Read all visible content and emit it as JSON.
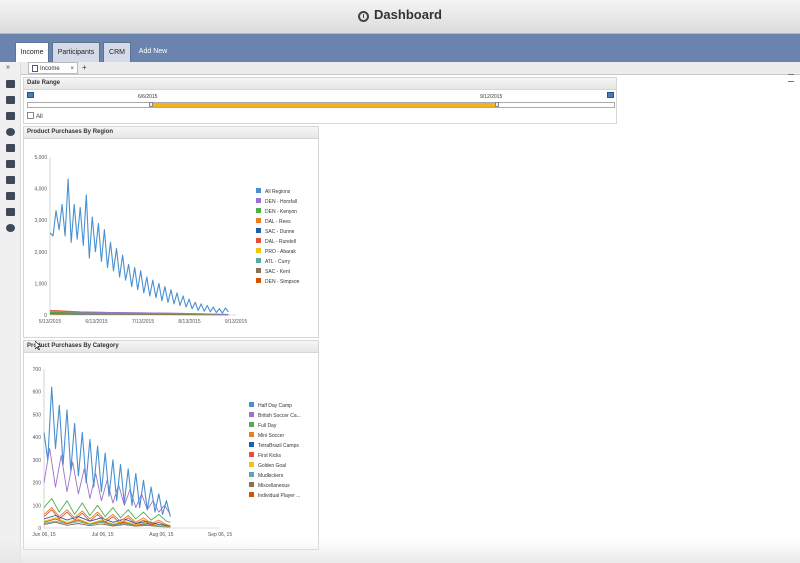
{
  "window": {
    "title": "Dashboard"
  },
  "tabs": [
    {
      "label": "Income",
      "active": true
    },
    {
      "label": "Participants",
      "active": false
    },
    {
      "label": "CRM",
      "active": false
    },
    {
      "label": "Add New",
      "active": false
    }
  ],
  "subtab": {
    "label": "Income",
    "close": "×",
    "add": "+"
  },
  "toolbar": {
    "expand": "»"
  },
  "date_range": {
    "title": "Date Range",
    "start": "6/6/2015",
    "end": "9/12/2015",
    "start_frac": 0.21,
    "end_frac": 0.8,
    "all_label": "All"
  },
  "colors": {
    "accent_range": "#f0b323",
    "tab_band": "#6b84ad"
  },
  "chart_data": [
    {
      "type": "line",
      "title": "Product Purchases By Region",
      "x_ticks": [
        "5/13/2015",
        "6/13/2015",
        "7/13/2015",
        "8/13/2015",
        "9/13/2015"
      ],
      "y_ticks": [
        "0",
        "1,000",
        "2,000",
        "3,000",
        "4,000",
        "5,000"
      ],
      "xlim": [
        0,
        123
      ],
      "ylim": [
        0,
        5000
      ],
      "grid": false,
      "legend": "right",
      "legend_entries": [
        "All Regions",
        "DEN - Horsfall",
        "DEN - Kenyon",
        "DAL - Rees",
        "SAC - Dunne",
        "DAL - Rundell",
        "PRO - Abarak",
        "ATL - Curry",
        "SAC - Kent",
        "DEN - Simpson"
      ],
      "series": [
        {
          "name": "All Regions",
          "color": "#4a90d0",
          "x": [
            0,
            2,
            4,
            6,
            8,
            10,
            12,
            14,
            16,
            18,
            20,
            22,
            24,
            26,
            28,
            30,
            32,
            34,
            36,
            38,
            40,
            42,
            44,
            46,
            48,
            50,
            52,
            54,
            56,
            58,
            60,
            62,
            64,
            66,
            68,
            70,
            72,
            74,
            76,
            78,
            80,
            82,
            84,
            86,
            88,
            90,
            92,
            94,
            96,
            98,
            100,
            102,
            104,
            106,
            108,
            110,
            112,
            114,
            116,
            118
          ],
          "y": [
            2600,
            2500,
            3300,
            2700,
            3500,
            2500,
            4300,
            2300,
            3500,
            2400,
            3400,
            2200,
            3800,
            1800,
            3100,
            2000,
            2900,
            1700,
            2700,
            1500,
            2300,
            1400,
            2100,
            1200,
            1900,
            1100,
            1600,
            900,
            1500,
            800,
            1400,
            700,
            1200,
            600,
            1100,
            550,
            1000,
            450,
            900,
            400,
            800,
            350,
            700,
            300,
            600,
            250,
            500,
            200,
            400,
            150,
            350,
            120,
            300,
            100,
            250,
            80,
            200,
            60,
            220,
            100
          ]
        },
        {
          "name": "DEN - Horsfall",
          "color": "#9b72cf",
          "x": [
            0,
            20,
            40,
            60,
            80,
            100,
            118
          ],
          "y": [
            120,
            90,
            80,
            70,
            60,
            40,
            20
          ]
        },
        {
          "name": "DEN - Kenyon",
          "color": "#4caf50",
          "x": [
            0,
            20,
            40,
            60,
            80,
            100,
            118
          ],
          "y": [
            80,
            60,
            55,
            50,
            40,
            30,
            15
          ]
        },
        {
          "name": "DAL - Rees",
          "color": "#e67e22",
          "x": [
            0,
            20,
            40,
            60,
            80,
            100,
            118
          ],
          "y": [
            60,
            50,
            45,
            40,
            30,
            20,
            10
          ]
        },
        {
          "name": "SAC - Dunne",
          "color": "#1f5fa8",
          "x": [
            0,
            20,
            40,
            60,
            80,
            100,
            118
          ],
          "y": [
            40,
            35,
            30,
            25,
            20,
            15,
            8
          ]
        },
        {
          "name": "DAL - Rundell",
          "color": "#e74c3c",
          "x": [
            0,
            20,
            40,
            60,
            80,
            100,
            118
          ],
          "y": [
            150,
            100,
            80,
            70,
            50,
            30,
            20
          ]
        },
        {
          "name": "PRO - Abarak",
          "color": "#f1c40f",
          "x": [
            0,
            20,
            40,
            60,
            80,
            100,
            118
          ],
          "y": [
            30,
            25,
            20,
            18,
            15,
            10,
            5
          ]
        },
        {
          "name": "ATL - Curry",
          "color": "#5aa7a7",
          "x": [
            0,
            20,
            40,
            60,
            80,
            100,
            118
          ],
          "y": [
            25,
            20,
            18,
            15,
            12,
            8,
            4
          ]
        },
        {
          "name": "SAC - Kent",
          "color": "#8e6e53",
          "x": [
            0,
            20,
            40,
            60,
            80,
            100,
            118
          ],
          "y": [
            20,
            15,
            14,
            12,
            10,
            6,
            3
          ]
        },
        {
          "name": "DEN - Simpson",
          "color": "#d35400",
          "x": [
            0,
            20,
            40,
            60,
            80,
            100,
            118
          ],
          "y": [
            90,
            70,
            60,
            50,
            40,
            25,
            12
          ]
        }
      ]
    },
    {
      "type": "line",
      "title": "Product Purchases By Category",
      "x_ticks": [
        "Jun 06, 15",
        "Jul 06, 15",
        "Aug 06, 15",
        "Sep 06, 15"
      ],
      "y_ticks": [
        "0",
        "100",
        "200",
        "300",
        "400",
        "500",
        "600",
        "700"
      ],
      "xlim": [
        0,
        92
      ],
      "ylim": [
        0,
        700
      ],
      "grid": false,
      "legend": "right",
      "legend_entries": [
        "Half Day Camp",
        "British Soccer Ca...",
        "Full Day",
        "Mini Soccer",
        "TetraBrazil Camps",
        "First Kicks",
        "Golden Goal",
        "Mudkickers",
        "Miscellaneous",
        "Individual Player ..."
      ],
      "series": [
        {
          "name": "Half Day Camp",
          "color": "#4a90d0",
          "x": [
            0,
            2,
            4,
            6,
            8,
            10,
            12,
            14,
            16,
            18,
            20,
            22,
            24,
            26,
            28,
            30,
            32,
            34,
            36,
            38,
            40,
            42,
            44,
            46,
            48,
            50,
            52,
            54,
            56,
            58,
            60,
            62,
            64,
            66
          ],
          "y": [
            420,
            300,
            620,
            350,
            540,
            280,
            520,
            250,
            460,
            230,
            420,
            200,
            390,
            180,
            360,
            160,
            330,
            140,
            300,
            120,
            280,
            110,
            260,
            100,
            240,
            90,
            210,
            80,
            180,
            70,
            150,
            60,
            120,
            50
          ]
        },
        {
          "name": "British Soccer Ca...",
          "color": "#9b72cf",
          "x": [
            0,
            3,
            6,
            9,
            12,
            15,
            18,
            21,
            24,
            27,
            30,
            33,
            36,
            39,
            42,
            45,
            48,
            51,
            54,
            57,
            60,
            63,
            66
          ],
          "y": [
            200,
            350,
            180,
            320,
            160,
            290,
            150,
            260,
            130,
            240,
            120,
            210,
            110,
            190,
            100,
            170,
            90,
            150,
            80,
            120,
            70,
            100,
            60
          ]
        },
        {
          "name": "Full Day",
          "color": "#4caf50",
          "x": [
            0,
            4,
            8,
            12,
            16,
            20,
            24,
            28,
            32,
            36,
            40,
            44,
            48,
            52,
            56,
            60,
            64,
            66
          ],
          "y": [
            90,
            130,
            70,
            120,
            60,
            110,
            55,
            100,
            50,
            90,
            45,
            80,
            40,
            70,
            35,
            60,
            30,
            25
          ]
        },
        {
          "name": "Mini Soccer",
          "color": "#e67e22",
          "x": [
            0,
            4,
            8,
            12,
            16,
            20,
            24,
            28,
            32,
            36,
            40,
            44,
            48,
            52,
            56,
            60,
            64,
            66
          ],
          "y": [
            60,
            90,
            50,
            80,
            45,
            75,
            40,
            70,
            35,
            60,
            30,
            55,
            25,
            45,
            20,
            35,
            15,
            10
          ]
        },
        {
          "name": "TetraBrazil Camps",
          "color": "#1f5fa8",
          "x": [
            0,
            6,
            12,
            18,
            24,
            30,
            36,
            42,
            48,
            54,
            60,
            66
          ],
          "y": [
            40,
            55,
            35,
            50,
            30,
            45,
            25,
            40,
            20,
            30,
            15,
            10
          ]
        },
        {
          "name": "First Kicks",
          "color": "#e74c3c",
          "x": [
            0,
            4,
            8,
            12,
            16,
            20,
            24,
            28,
            32,
            36,
            40,
            44,
            48,
            52,
            56,
            60,
            64,
            66
          ],
          "y": [
            50,
            80,
            40,
            70,
            35,
            65,
            30,
            60,
            25,
            50,
            20,
            45,
            18,
            35,
            15,
            25,
            10,
            8
          ]
        },
        {
          "name": "Golden Goal",
          "color": "#f1c40f",
          "x": [
            0,
            6,
            12,
            18,
            24,
            30,
            36,
            42,
            48,
            54,
            60,
            66
          ],
          "y": [
            30,
            45,
            25,
            40,
            20,
            35,
            18,
            30,
            15,
            25,
            10,
            8
          ]
        },
        {
          "name": "Mudkickers",
          "color": "#5aa7a7",
          "x": [
            0,
            6,
            12,
            18,
            24,
            30,
            36,
            42,
            48,
            54,
            60,
            66
          ],
          "y": [
            20,
            30,
            18,
            28,
            15,
            25,
            12,
            20,
            10,
            15,
            8,
            5
          ]
        },
        {
          "name": "Miscellaneous",
          "color": "#8e6e53",
          "x": [
            0,
            6,
            12,
            18,
            24,
            30,
            36,
            42,
            48,
            54,
            60,
            66
          ],
          "y": [
            15,
            25,
            12,
            20,
            10,
            18,
            9,
            15,
            8,
            12,
            6,
            4
          ]
        },
        {
          "name": "Individual Player ...",
          "color": "#d35400",
          "x": [
            0,
            6,
            12,
            18,
            24,
            30,
            36,
            42,
            48,
            54,
            60,
            66
          ],
          "y": [
            25,
            40,
            20,
            35,
            18,
            30,
            15,
            25,
            12,
            20,
            10,
            6
          ]
        }
      ]
    }
  ]
}
